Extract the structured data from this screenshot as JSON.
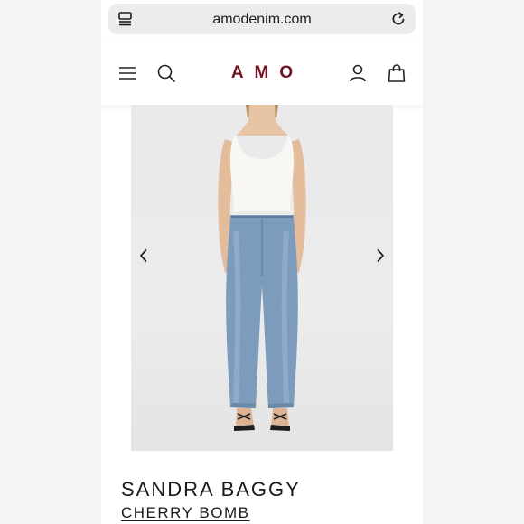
{
  "browser": {
    "url": "amodenim.com",
    "tabs_icon": "tabs-icon",
    "reload_icon": "reload-icon"
  },
  "header": {
    "brand": "AMO",
    "brand_color": "#6d1322",
    "icons": [
      "menu-icon",
      "search-icon",
      "account-icon",
      "bag-icon"
    ]
  },
  "gallery": {
    "prev_icon": "chevron-left-icon",
    "next_icon": "chevron-right-icon"
  },
  "product": {
    "name": "SANDRA BAGGY",
    "color": "CHERRY BOMB"
  }
}
